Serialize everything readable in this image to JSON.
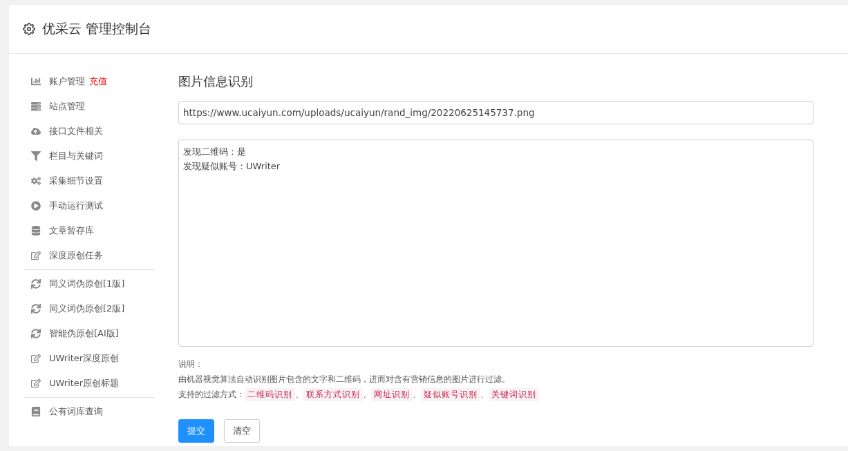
{
  "header": {
    "title": "优采云 管理控制台"
  },
  "sidebar": {
    "groups": [
      {
        "items": [
          {
            "kind": "chart",
            "label": "账户管理",
            "badge": "充值"
          },
          {
            "kind": "server",
            "label": "站点管理"
          },
          {
            "kind": "cloud",
            "label": "接口文件相关"
          },
          {
            "kind": "filter",
            "label": "栏目与关键词"
          },
          {
            "kind": "cogs",
            "label": "采集细节设置"
          },
          {
            "kind": "play",
            "label": "手动运行测试"
          },
          {
            "kind": "database",
            "label": "文章暂存库"
          },
          {
            "kind": "edit",
            "label": "深度原创任务"
          }
        ]
      },
      {
        "items": [
          {
            "kind": "refresh",
            "label": "同义词伪原创[1版]"
          },
          {
            "kind": "refresh",
            "label": "同义词伪原创[2版]"
          },
          {
            "kind": "refresh",
            "label": "智能伪原创[AI版]"
          },
          {
            "kind": "edit",
            "label": "UWriter深度原创"
          },
          {
            "kind": "edit",
            "label": "UWriter原创标题"
          }
        ]
      },
      {
        "items": [
          {
            "kind": "book",
            "label": "公有词库查询"
          }
        ]
      }
    ]
  },
  "main": {
    "title": "图片信息识别",
    "url_field": {
      "value": "https://www.ucaiyun.com/uploads/ucaiyun/rand_img/20220625145737.png"
    },
    "result_field": {
      "lines": [
        "发现二维码：是",
        "发现疑似账号：UWriter"
      ]
    },
    "notes": {
      "heading": "说明：",
      "description": "由机器视觉算法自动识别图片包含的文字和二维码，进而对含有营销信息的图片进行过滤。",
      "filters_label": "支持的过滤方式：",
      "filters": [
        {
          "label": "二维码识别",
          "separator": "、"
        },
        {
          "label": "联系方式识别",
          "separator": "、"
        },
        {
          "label": "网址识别",
          "separator": "、"
        },
        {
          "label": "疑似账号识别",
          "separator": "、"
        },
        {
          "label": "关键词识别"
        }
      ]
    },
    "buttons": [
      {
        "kind": "primary",
        "label": "提交"
      },
      {
        "kind": "default",
        "label": "清空"
      }
    ]
  }
}
